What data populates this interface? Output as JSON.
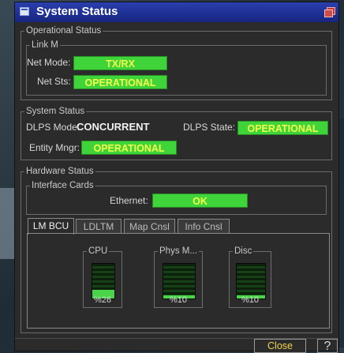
{
  "window": {
    "title": "System Status"
  },
  "operational": {
    "label": "Operational Status",
    "link": {
      "label": "Link M",
      "net_mode_label": "Net Mode:",
      "net_mode_value": "TX/RX",
      "net_sts_label": "Net Sts:",
      "net_sts_value": "OPERATIONAL"
    }
  },
  "system": {
    "label": "System Status",
    "dlps_mode_label": "DLPS Mode:",
    "dlps_mode_value": "CONCURRENT",
    "dlps_state_label": "DLPS State:",
    "dlps_state_value": "OPERATIONAL",
    "entity_mngr_label": "Entity Mngr:",
    "entity_mngr_value": "OPERATIONAL"
  },
  "hardware": {
    "label": "Hardware Status",
    "interface_cards": {
      "label": "Interface Cards",
      "ethernet_label": "Ethernet:",
      "ethernet_value": "OK"
    },
    "tabs": [
      {
        "label": "LM BCU",
        "active": true
      },
      {
        "label": "LDLTM",
        "active": false
      },
      {
        "label": "Map Cnsl",
        "active": false
      },
      {
        "label": "Info Cnsl",
        "active": false
      }
    ],
    "gauges": [
      {
        "label": "CPU",
        "value_text": "%26",
        "level": 0.26
      },
      {
        "label": "Phys M...",
        "value_text": "%10",
        "level": 0.1
      },
      {
        "label": "Disc",
        "value_text": "%10",
        "level": 0.1
      }
    ]
  },
  "footer": {
    "close_label": "Close",
    "help_label": "?"
  },
  "colors": {
    "status_green": "#3fd43a",
    "status_text": "#f6ff4a",
    "titlebar": "#1f32a0"
  }
}
